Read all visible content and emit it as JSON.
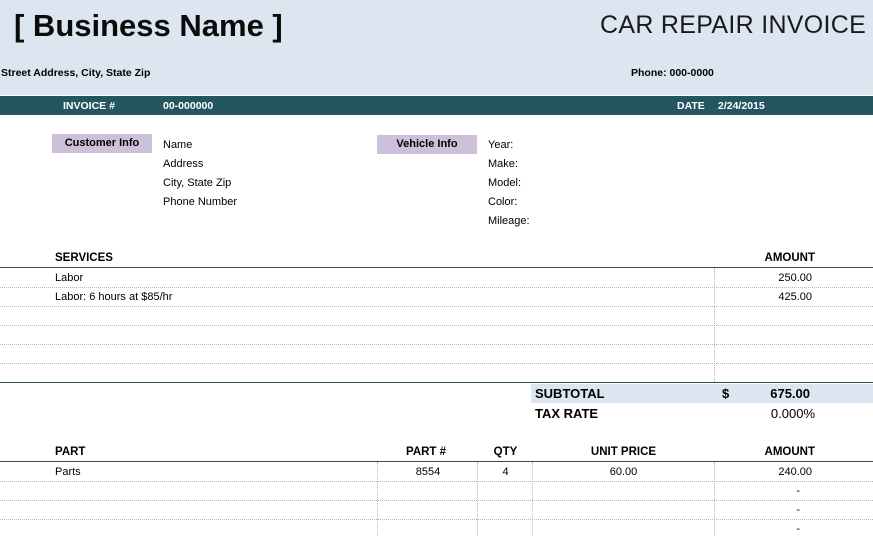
{
  "header": {
    "business_name": "[ Business Name ]",
    "title": "CAR REPAIR INVOICE",
    "address": "Street Address, City, State Zip",
    "phone": "Phone: 000-0000"
  },
  "bar": {
    "invoice_label": "INVOICE #",
    "invoice_number": "00-000000",
    "date_label": "DATE",
    "date_value": "2/24/2015"
  },
  "customer": {
    "tag": "Customer Info",
    "lines": [
      "Name",
      "Address",
      "City, State  Zip",
      "Phone Number"
    ]
  },
  "vehicle": {
    "tag": "Vehicle Info",
    "lines": [
      "Year:",
      "Make:",
      "Model:",
      "Color:",
      "Mileage:"
    ]
  },
  "services": {
    "header": "SERVICES",
    "amount_header": "AMOUNT",
    "rows": [
      {
        "desc": "Labor",
        "amount": "250.00"
      },
      {
        "desc": "Labor: 6 hours at $85/hr",
        "amount": "425.00"
      }
    ]
  },
  "totals": {
    "subtotal_label": "SUBTOTAL",
    "currency": "$",
    "subtotal_value": "675.00",
    "tax_label": "TAX RATE",
    "tax_value": "0.000%"
  },
  "parts": {
    "headers": {
      "part": "PART",
      "part_no": "PART  #",
      "qty": "QTY",
      "unit_price": "UNIT PRICE",
      "amount": "AMOUNT"
    },
    "rows": [
      {
        "part": "Parts",
        "part_no": "8554",
        "qty": "4",
        "unit_price": "60.00",
        "amount": "240.00"
      },
      {
        "part": "",
        "part_no": "",
        "qty": "",
        "unit_price": "",
        "amount": "-"
      },
      {
        "part": "",
        "part_no": "",
        "qty": "",
        "unit_price": "",
        "amount": "-"
      },
      {
        "part": "",
        "part_no": "",
        "qty": "",
        "unit_price": "",
        "amount": "-"
      }
    ]
  }
}
